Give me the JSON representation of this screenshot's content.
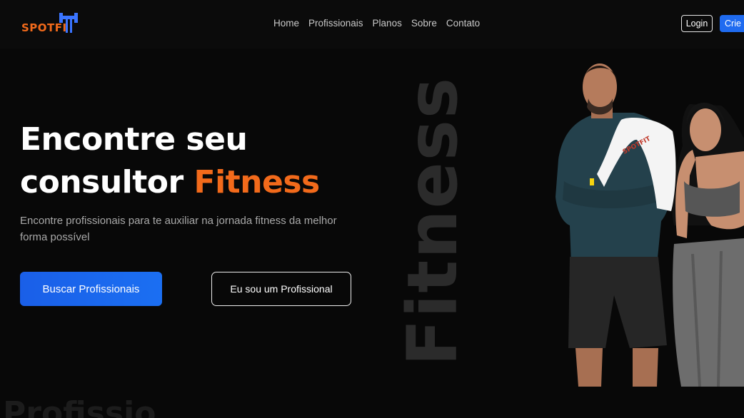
{
  "header": {
    "logo_text": "SPOTFI",
    "nav": [
      "Home",
      "Profissionais",
      "Planos",
      "Sobre",
      "Contato"
    ],
    "login_label": "Login",
    "create_label": "Crie"
  },
  "hero": {
    "title_line1": "Encontre seu",
    "title_line2_prefix": "consultor ",
    "title_accent": "Fitness",
    "subtitle": "Encontre profissionais para te auxiliar na jornada fitness da melhor forma possível",
    "primary_button": "Buscar Profissionais",
    "secondary_button": "Eu sou um Profissional",
    "background_word": "Fitness",
    "background_word_bottom": "Profissio",
    "towel_print": "SPOTFIT"
  },
  "colors": {
    "background": "#080808",
    "accent": "#f26a1b",
    "primary_blue": "#1f6bf0",
    "bg_word": "#2b2b2b"
  }
}
